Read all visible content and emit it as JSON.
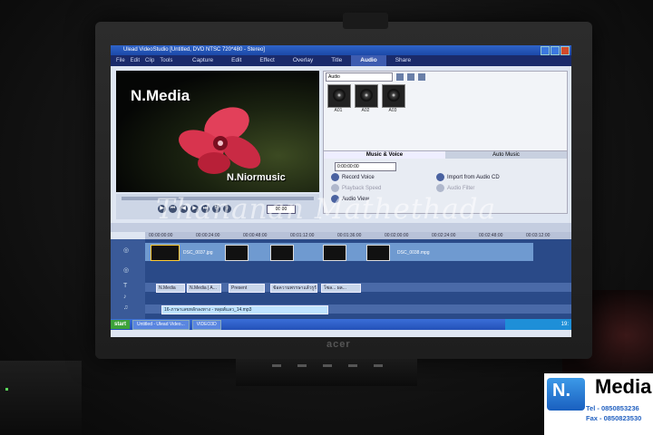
{
  "window": {
    "title": "Ulead VideoStudio [Untitled, DVD NTSC 720*480 - Stereo]",
    "menu": [
      "File",
      "Edit",
      "Clip",
      "Tools"
    ],
    "steps": [
      "Capture",
      "Edit",
      "Effect",
      "Overlay",
      "Title",
      "Audio",
      "Share"
    ],
    "active_step": "Audio"
  },
  "preview": {
    "title_text": "N.Media",
    "subtitle_text": "N.Niormusic",
    "timecode": "00:00"
  },
  "library": {
    "dropdown": "Audio",
    "thumbs": [
      "A01",
      "A02",
      "A03"
    ]
  },
  "options": {
    "tabs": [
      "Music & Voice",
      "Auto Music"
    ],
    "timecode": "0:00:00:00",
    "record_voice": "Record Voice",
    "playback_speed": "Playback Speed",
    "audio_view": "Audio View",
    "import_cd": "Import from Audio CD",
    "audio_filter": "Audio Filter"
  },
  "timeline": {
    "ruler": [
      "00:00:00:00",
      "00:00:24:00",
      "00:00:48:00",
      "00:01:12:00",
      "00:01:36:00",
      "00:02:00:00",
      "00:02:24:00",
      "00:02:48:00",
      "00:03:12:00"
    ],
    "video_clips": [
      "DSC_0037.jpg",
      "DSC_0038.mpg"
    ],
    "title_clips": [
      "N.Media",
      "N.Media | A...",
      "Present",
      "ข้อความพรรษาแล้วรูรัน",
      "โซล... ผล..."
    ],
    "music_clip": "16-ภาษาเลขหลักลงทาง - หลุยส์แลว_14.mp3"
  },
  "taskbar": {
    "start": "start",
    "tasks": [
      "Untitled - Ulead Video...",
      "VIDEO3D"
    ],
    "clock": "19:"
  },
  "watermark": "Thananan Mathethada",
  "monitor_brand": "acer",
  "logo": {
    "mark": "N.",
    "word": "Media",
    "tel": "Tel - 0850853236",
    "fax": "Fax - 0850823530"
  }
}
